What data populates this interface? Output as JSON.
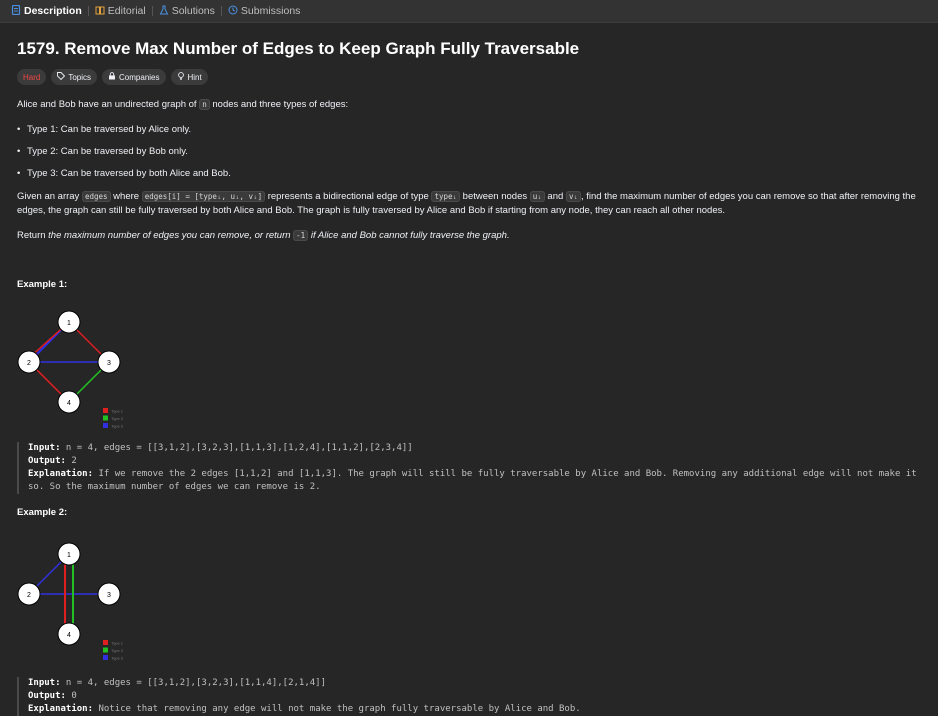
{
  "tabs": [
    {
      "label": "Description",
      "icon": "document-icon"
    },
    {
      "label": "Editorial",
      "icon": "book-icon"
    },
    {
      "label": "Solutions",
      "icon": "flask-icon"
    },
    {
      "label": "Submissions",
      "icon": "history-icon"
    }
  ],
  "problem": {
    "title": "1579. Remove Max Number of Edges to Keep Graph Fully Traversable",
    "difficulty": "Hard",
    "tags": [
      "Topics",
      "Companies",
      "Hint"
    ]
  },
  "description": {
    "intro_a": "Alice and Bob have an undirected graph of ",
    "intro_code": "n",
    "intro_b": " nodes and three types of edges:",
    "types": [
      "Type 1: Can be traversed by Alice only.",
      "Type 2: Can be traversed by Bob only.",
      "Type 3: Can be traversed by both Alice and Bob."
    ],
    "p2_a": "Given an array ",
    "p2_code1": "edges",
    "p2_b": " where ",
    "p2_code2": "edges[i] = [typeᵢ, uᵢ, vᵢ]",
    "p2_c": " represents a bidirectional edge of type ",
    "p2_code3": "typeᵢ",
    "p2_d": " between nodes ",
    "p2_code4": "uᵢ",
    "p2_e": " and ",
    "p2_code5": "vᵢ",
    "p2_f": ", find the maximum number of edges you can remove so that after removing the edges, the graph can still be fully traversed by both Alice and Bob. The graph is fully traversed by Alice and Bob if starting from any node, they can reach all other nodes.",
    "p3_a": "Return ",
    "p3_em1": "the maximum number of edges you can remove, or return ",
    "p3_code": "-1",
    "p3_em2": " if Alice and Bob cannot fully traverse the graph."
  },
  "examples": [
    {
      "title": "Example 1:",
      "nodes": [
        "1",
        "2",
        "3",
        "4"
      ],
      "legend": [
        "Type 1",
        "Type 2",
        "Type 3"
      ],
      "input_label": "Input:",
      "input": " n = 4, edges = [[3,1,2],[3,2,3],[1,1,3],[1,2,4],[1,1,2],[2,3,4]]",
      "output_label": "Output:",
      "output": " 2",
      "explanation_label": "Explanation:",
      "explanation": " If we remove the 2 edges [1,1,2] and [1,1,3]. The graph will still be fully traversable by Alice and Bob. Removing any additional edge will not make it so. So the maximum number of edges we can remove is 2."
    },
    {
      "title": "Example 2:",
      "nodes": [
        "1",
        "2",
        "3",
        "4"
      ],
      "legend": [
        "Type 1",
        "Type 2",
        "Type 3"
      ],
      "input_label": "Input:",
      "input": " n = 4, edges = [[3,1,2],[3,2,3],[1,1,4],[2,1,4]]",
      "output_label": "Output:",
      "output": " 0",
      "explanation_label": "Explanation:",
      "explanation": " Notice that removing any edge will not make the graph fully traversable by Alice and Bob."
    }
  ],
  "colors": {
    "background": "#262626",
    "type1": "#e02020",
    "type2": "#22c022",
    "type3": "#3030e0",
    "hard": "#ef4743"
  }
}
